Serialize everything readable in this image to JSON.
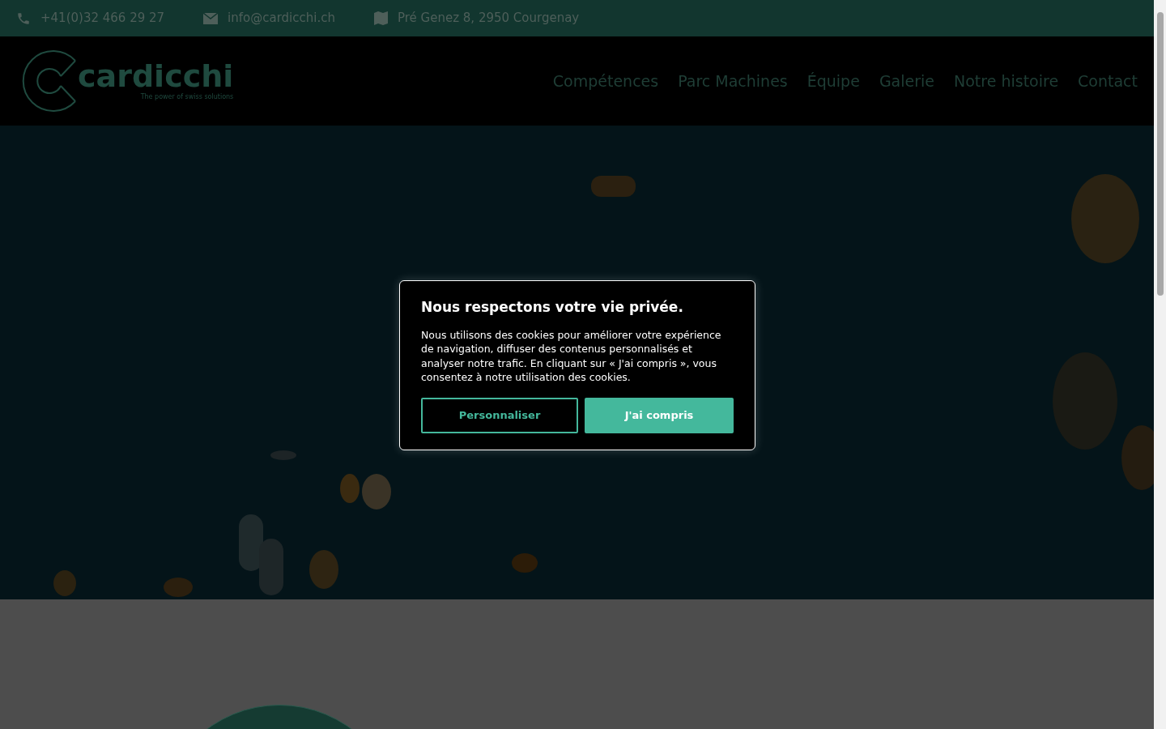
{
  "topbar": {
    "phone": "+41(0)32 466 29 27",
    "email": "info@cardicchi.ch",
    "address": "Pré Genez 8, 2950 Courgenay"
  },
  "logo": {
    "name": "cardicchi",
    "tagline": "The power of swiss solutions"
  },
  "nav": [
    "Compétences",
    "Parc Machines",
    "Équipe",
    "Galerie",
    "Notre histoire",
    "Contact"
  ],
  "cookie_dialog": {
    "title": "Nous respectons votre vie privée.",
    "text": "Nous utilisons des cookies pour améliorer votre expérience de navigation, diffuser des contenus personnalisés et analyser notre trafic. En cliquant sur « J'ai compris », vous consentez à notre utilisation des cookies.",
    "buttons": [
      {
        "label": "Personnaliser",
        "kind": "outline"
      },
      {
        "label": "J'ai compris",
        "kind": "primary"
      }
    ]
  }
}
